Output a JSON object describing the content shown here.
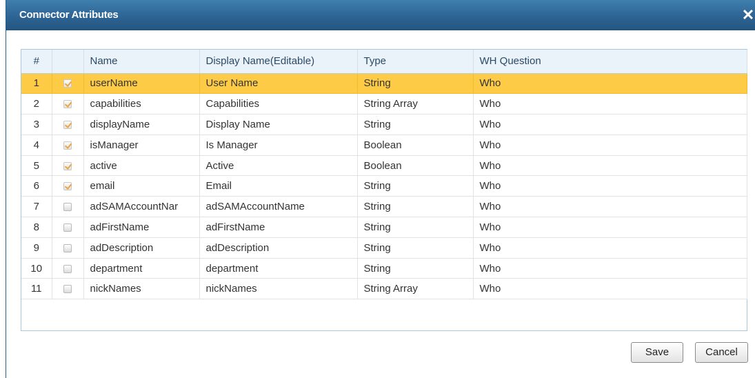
{
  "dialog": {
    "title": "Connector Attributes",
    "close_glyph": "✕"
  },
  "table": {
    "headers": {
      "num": "#",
      "check": "",
      "name": "Name",
      "display_name": "Display Name(Editable)",
      "type": "Type",
      "wh_question": "WH Question"
    },
    "rows": [
      {
        "num": "1",
        "checked": true,
        "name": "userName",
        "display_name": "User Name",
        "type": "String",
        "wh_question": "Who"
      },
      {
        "num": "2",
        "checked": true,
        "name": "capabilities",
        "display_name": "Capabilities",
        "type": "String Array",
        "wh_question": "Who"
      },
      {
        "num": "3",
        "checked": true,
        "name": "displayName",
        "display_name": "Display Name",
        "type": "String",
        "wh_question": "Who"
      },
      {
        "num": "4",
        "checked": true,
        "name": "isManager",
        "display_name": "Is Manager",
        "type": "Boolean",
        "wh_question": "Who"
      },
      {
        "num": "5",
        "checked": true,
        "name": "active",
        "display_name": "Active",
        "type": "Boolean",
        "wh_question": "Who"
      },
      {
        "num": "6",
        "checked": true,
        "name": "email",
        "display_name": "Email",
        "type": "String",
        "wh_question": "Who"
      },
      {
        "num": "7",
        "checked": false,
        "name": "adSAMAccountNar",
        "display_name": "adSAMAccountName",
        "type": "String",
        "wh_question": "Who"
      },
      {
        "num": "8",
        "checked": false,
        "name": "adFirstName",
        "display_name": "adFirstName",
        "type": "String",
        "wh_question": "Who"
      },
      {
        "num": "9",
        "checked": false,
        "name": "adDescription",
        "display_name": "adDescription",
        "type": "String",
        "wh_question": "Who"
      },
      {
        "num": "10",
        "checked": false,
        "name": "department",
        "display_name": "department",
        "type": "String",
        "wh_question": "Who"
      },
      {
        "num": "11",
        "checked": false,
        "name": "nickNames",
        "display_name": "nickNames",
        "type": "String Array",
        "wh_question": "Who"
      }
    ]
  },
  "buttons": {
    "save": "Save",
    "cancel": "Cancel"
  },
  "colors": {
    "titlebar": "#2d6494",
    "selected_row": "#fdcb46",
    "check_mark": "#f0a33a"
  }
}
